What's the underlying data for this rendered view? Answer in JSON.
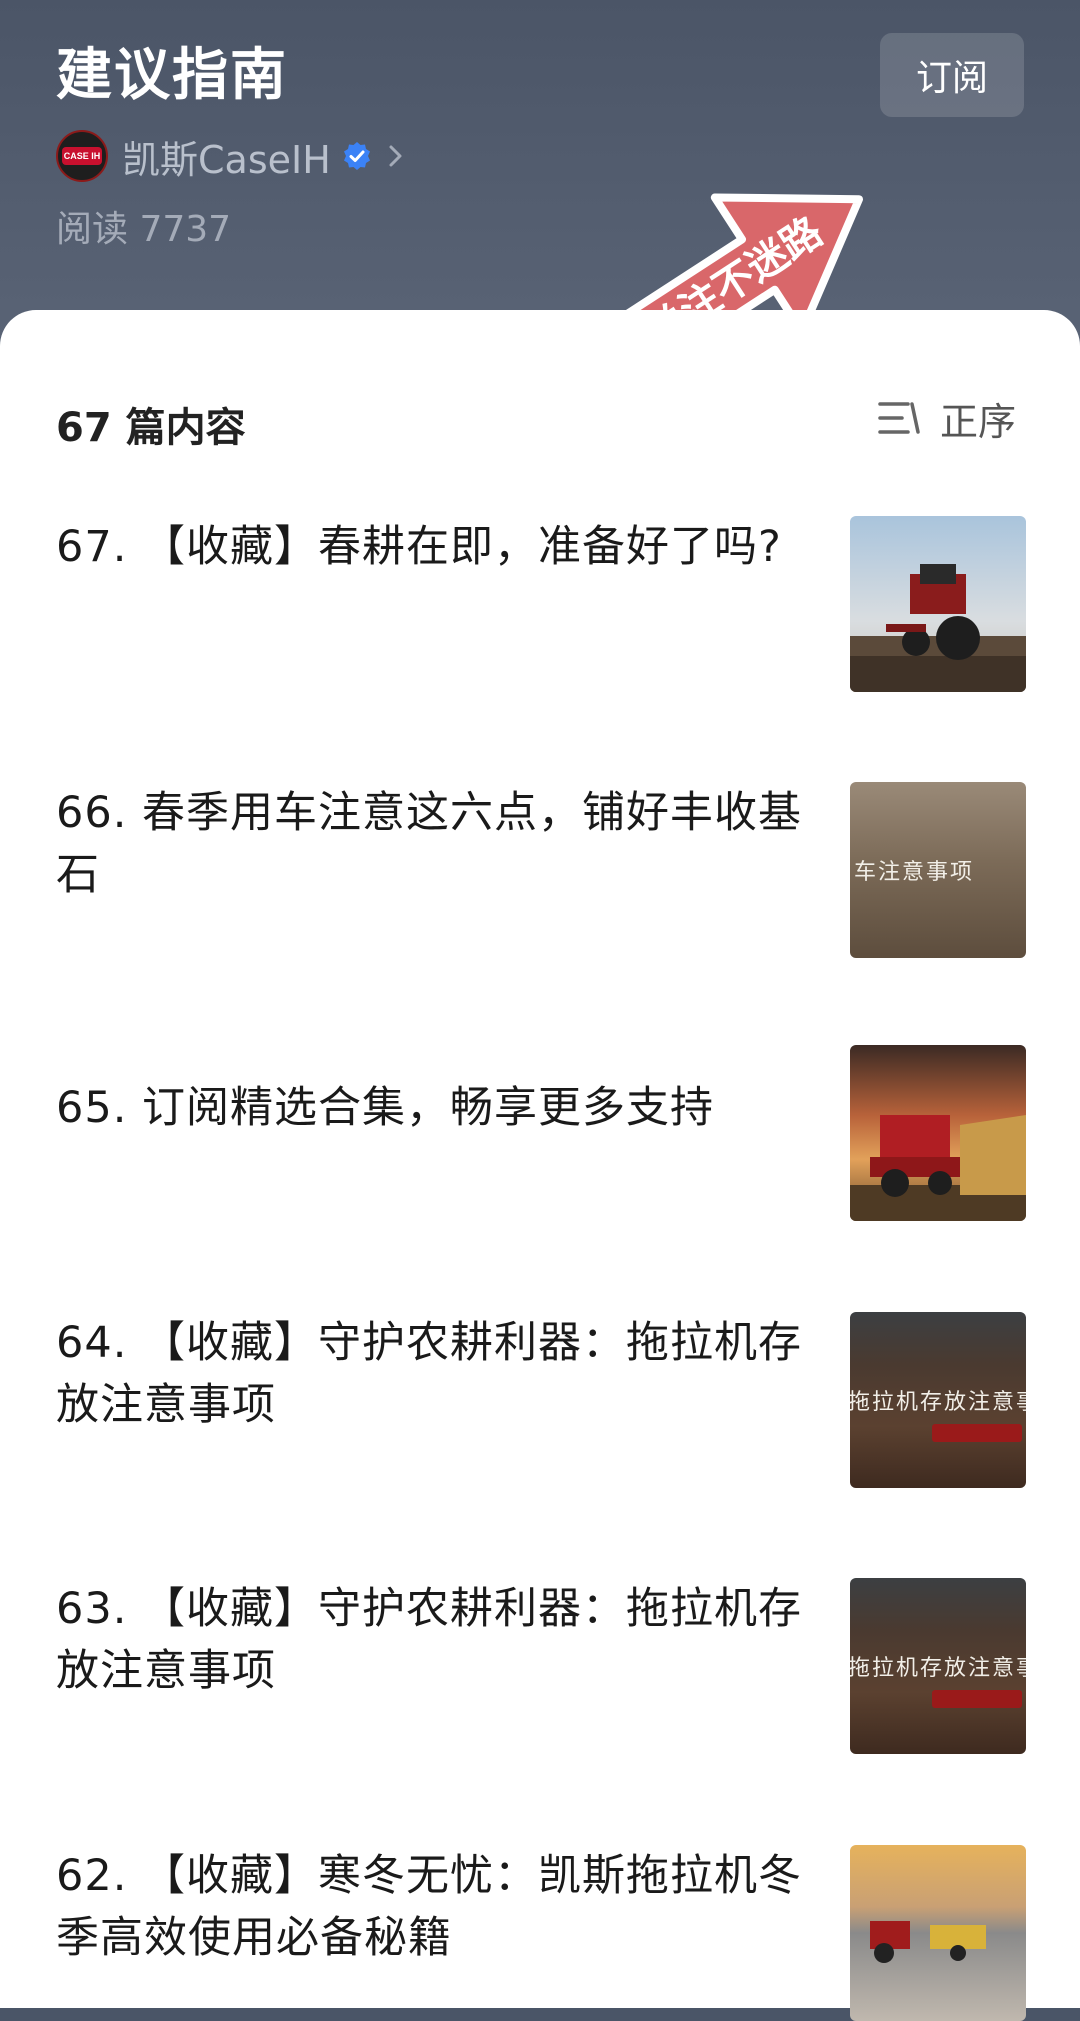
{
  "header": {
    "title": "建议指南",
    "subscribe_label": "订阅",
    "author": "凯斯CaseIH",
    "avatar_text": "CASE IH",
    "read_count": "阅读 7737",
    "sticker_text": "关注不迷路"
  },
  "list": {
    "count_label": "67 篇内容",
    "sort_label": "正序",
    "items": [
      {
        "title": "67. 【收藏】春耕在即，准备好了吗?",
        "thumb_text": ""
      },
      {
        "title": "66. 春季用车注意这六点，铺好丰收基石",
        "thumb_text": "车注意事项"
      },
      {
        "title": "65. 订阅精选合集，畅享更多支持",
        "thumb_text": ""
      },
      {
        "title": "64. 【收藏】守护农耕利器：拖拉机存放注意事项",
        "thumb_text": "拖拉机存放注意事项"
      },
      {
        "title": "63. 【收藏】守护农耕利器：拖拉机存放注意事项",
        "thumb_text": "拖拉机存放注意事项"
      },
      {
        "title": "62. 【收藏】寒冬无忧：凯斯拖拉机冬季高效使用必备秘籍",
        "thumb_text": ""
      }
    ]
  },
  "colors": {
    "header_bg": "#4b5567",
    "sticker": "#d9676a",
    "verified": "#3b82f6",
    "brand_red": "#c8102e"
  }
}
